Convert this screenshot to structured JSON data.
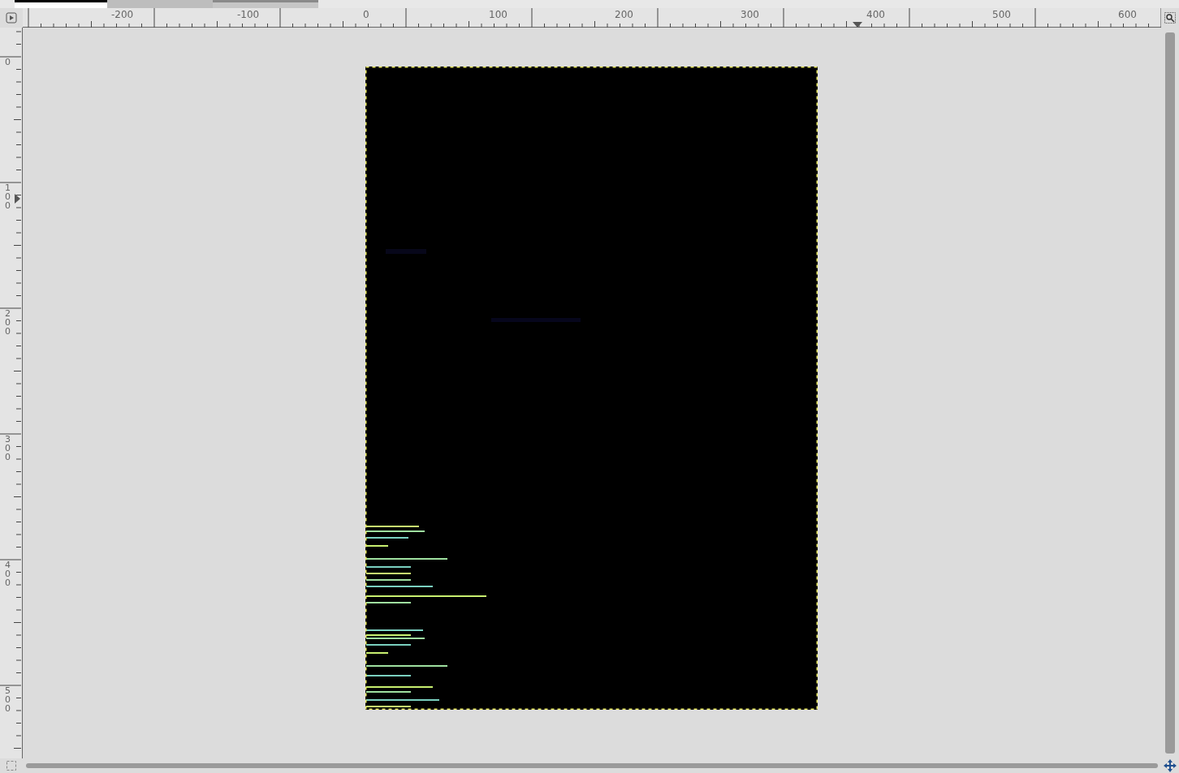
{
  "rulers": {
    "horizontal": [
      "-200",
      "-100",
      "0",
      "100",
      "200",
      "300",
      "400",
      "500",
      "600"
    ],
    "vertical": [
      "0",
      "100",
      "200",
      "300",
      "400",
      "500"
    ]
  }
}
